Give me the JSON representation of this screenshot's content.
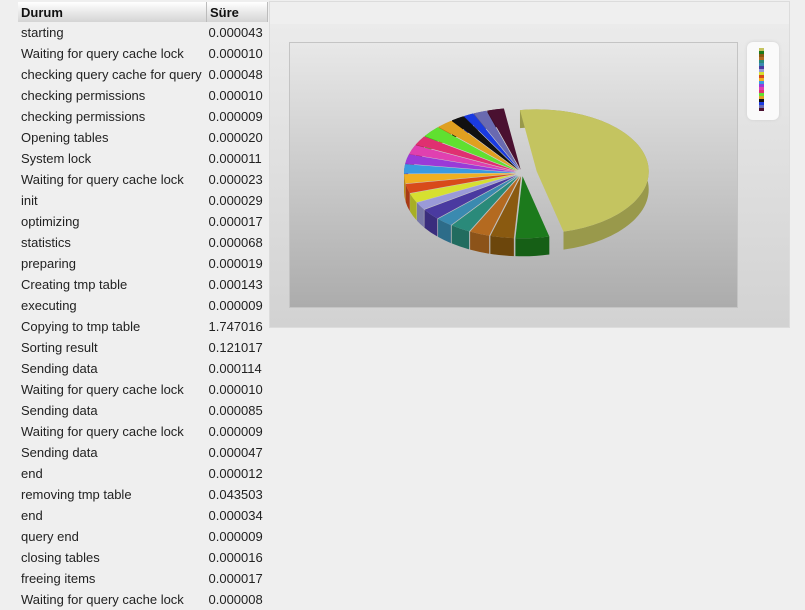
{
  "table": {
    "headers": {
      "state": "Durum",
      "duration": "Süre"
    },
    "rows": [
      {
        "state": "starting",
        "duration": "0.000043"
      },
      {
        "state": "Waiting for query cache lock",
        "duration": "0.000010"
      },
      {
        "state": "checking query cache for query",
        "duration": "0.000048"
      },
      {
        "state": "checking permissions",
        "duration": "0.000010"
      },
      {
        "state": "checking permissions",
        "duration": "0.000009"
      },
      {
        "state": "Opening tables",
        "duration": "0.000020"
      },
      {
        "state": "System lock",
        "duration": "0.000011"
      },
      {
        "state": "Waiting for query cache lock",
        "duration": "0.000023"
      },
      {
        "state": "init",
        "duration": "0.000029"
      },
      {
        "state": "optimizing",
        "duration": "0.000017"
      },
      {
        "state": "statistics",
        "duration": "0.000068"
      },
      {
        "state": "preparing",
        "duration": "0.000019"
      },
      {
        "state": "Creating tmp table",
        "duration": "0.000143"
      },
      {
        "state": "executing",
        "duration": "0.000009"
      },
      {
        "state": "Copying to tmp table",
        "duration": "1.747016"
      },
      {
        "state": "Sorting result",
        "duration": "0.121017"
      },
      {
        "state": "Sending data",
        "duration": "0.000114"
      },
      {
        "state": "Waiting for query cache lock",
        "duration": "0.000010"
      },
      {
        "state": "Sending data",
        "duration": "0.000085"
      },
      {
        "state": "Waiting for query cache lock",
        "duration": "0.000009"
      },
      {
        "state": "Sending data",
        "duration": "0.000047"
      },
      {
        "state": "end",
        "duration": "0.000012"
      },
      {
        "state": "removing tmp table",
        "duration": "0.043503"
      },
      {
        "state": "end",
        "duration": "0.000034"
      },
      {
        "state": "query end",
        "duration": "0.000009"
      },
      {
        "state": "closing tables",
        "duration": "0.000016"
      },
      {
        "state": "freeing items",
        "duration": "0.000017"
      },
      {
        "state": "Waiting for query cache lock",
        "duration": "0.000008"
      }
    ]
  },
  "chart_data": {
    "type": "pie",
    "style": "3d exploded",
    "legend": "right",
    "slices": [
      {
        "value": 0.5,
        "color": "#c4c460"
      },
      {
        "value": 0.05,
        "color": "#1c7a1c"
      },
      {
        "value": 0.035,
        "color": "#8a5a10"
      },
      {
        "value": 0.03,
        "color": "#b46a20"
      },
      {
        "value": 0.03,
        "color": "#2a8a7a"
      },
      {
        "value": 0.025,
        "color": "#3a8ab0"
      },
      {
        "value": 0.03,
        "color": "#4a3aa0"
      },
      {
        "value": 0.02,
        "color": "#9a9ad8"
      },
      {
        "value": 0.025,
        "color": "#d6e030"
      },
      {
        "value": 0.025,
        "color": "#d84a1a"
      },
      {
        "value": 0.025,
        "color": "#f0b020"
      },
      {
        "value": 0.025,
        "color": "#3a9ae0"
      },
      {
        "value": 0.025,
        "color": "#9a3ad8"
      },
      {
        "value": 0.025,
        "color": "#e040b0"
      },
      {
        "value": 0.025,
        "color": "#e03070"
      },
      {
        "value": 0.03,
        "color": "#60e030"
      },
      {
        "value": 0.025,
        "color": "#e0a020"
      },
      {
        "value": 0.02,
        "color": "#111111"
      },
      {
        "value": 0.015,
        "color": "#1a3ae0"
      },
      {
        "value": 0.02,
        "color": "#6a6ab0"
      },
      {
        "value": 0.025,
        "color": "#4a1030"
      }
    ]
  }
}
